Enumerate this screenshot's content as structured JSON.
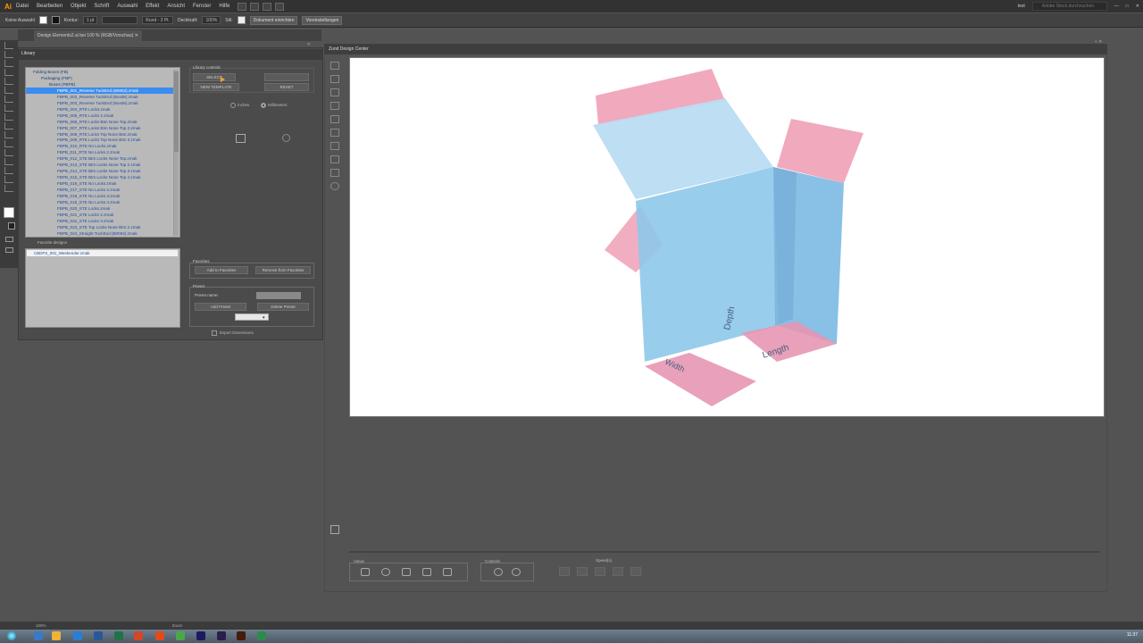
{
  "app": {
    "logo": "Ai",
    "menu": [
      "Datei",
      "Bearbeiten",
      "Objekt",
      "Schrift",
      "Auswahl",
      "Effekt",
      "Ansicht",
      "Fenster",
      "Hilfe"
    ],
    "workspace": "test",
    "search_placeholder": "Adobe Stock durchsuchen"
  },
  "control_bar": {
    "selection": "Keine Auswahl",
    "stroke_label": "Kontur:",
    "stroke_value": "1 pt",
    "brush": "Rund - 3 Pt.",
    "opacity_label": "Deckkraft:",
    "opacity_value": "100%",
    "style_label": "Stil:",
    "doc_setup": "Dokument einrichten",
    "preferences": "Voreinstellungen"
  },
  "document_tab": "Design Elements2.ai bei 100 % (RGB/Vorschau)",
  "library": {
    "title": "Library",
    "tree": [
      {
        "label": "Folding Boxes (FB)",
        "level": 0,
        "group": true
      },
      {
        "label": "Packaging (FBP)",
        "level": 1,
        "group": true
      },
      {
        "label": "Boxes (FBPB)",
        "level": 2,
        "group": true
      },
      {
        "label": "FBPB_001_Reverse TuckEnd (B0002).zmak",
        "level": 3,
        "selected": true
      },
      {
        "label": "FBPB_002_Reverse TuckEnd (Box06).zmak",
        "level": 3
      },
      {
        "label": "FBPB_003_Reverse TuckEnd (Box06).zmak",
        "level": 3
      },
      {
        "label": "FBPB_004_RTE Locks.zmak",
        "level": 3
      },
      {
        "label": "FBPB_005_RTE Locks 2.zmak",
        "level": 3
      },
      {
        "label": "FBPB_006_RTE Locks Btm None Top.zmak",
        "level": 3
      },
      {
        "label": "FBPB_007_RTE Locks Btm None Top 2.zmak",
        "level": 3
      },
      {
        "label": "FBPB_008_RTE Locks Top None Btm.zmak",
        "level": 3
      },
      {
        "label": "FBPB_009_RTE Locks Top None Btm 2.zmak",
        "level": 3
      },
      {
        "label": "FBPB_010_RTE No Locks.zmak",
        "level": 3
      },
      {
        "label": "FBPB_011_RTE No Locks 2.zmak",
        "level": 3
      },
      {
        "label": "FBPB_012_STE Btm Locks None Top.zmak",
        "level": 3
      },
      {
        "label": "FBPB_013_STE Btm Locks None Top 2.zmak",
        "level": 3
      },
      {
        "label": "FBPB_014_STE Btm Locks None Top 3.zmak",
        "level": 3
      },
      {
        "label": "FBPB_015_STE Btm Locks None Top 4.zmak",
        "level": 3
      },
      {
        "label": "FBPB_016_STE No Locks.zmak",
        "level": 3
      },
      {
        "label": "FBPB_017_STE No Locks 2.zmak",
        "level": 3
      },
      {
        "label": "FBPB_018_STE No Locks 3.zmak",
        "level": 3
      },
      {
        "label": "FBPB_019_STE No Locks 4.zmak",
        "level": 3
      },
      {
        "label": "FBPB_020_STE Locks.zmak",
        "level": 3
      },
      {
        "label": "FBPB_021_STE Locks 2.zmak",
        "level": 3
      },
      {
        "label": "FBPB_022_STE Locks 3.zmak",
        "level": 3
      },
      {
        "label": "FBPB_023_STE Top Locks None Btm 2.zmak",
        "level": 3
      },
      {
        "label": "FBPB_024_Straight TuckEnd (B0004).zmak",
        "level": 3
      }
    ],
    "favorite_designs_label": "Favorite designs",
    "favorite_item": "CBDFS_001_Weekender.zmak",
    "controls_title": "Library controls",
    "select_btn": "SELECT",
    "new_template_btn": "NEW TEMPLATE",
    "reset_btn": "RESET",
    "unit_inches": "Inches",
    "unit_mm": "Millimeters",
    "favorites_title": "Favorites",
    "add_fav_btn": "Add to Favorites",
    "remove_fav_btn": "Remove from Favorites",
    "preset_title": "Preset",
    "preset_name_label": "Preset name:",
    "add_preset_btn": "Add Preset",
    "delete_preset_btn": "Delete Preset",
    "export_dims_label": "Export Dimensions"
  },
  "design_center": {
    "title": "Zund Design Center",
    "dims": {
      "depth": "Depth",
      "width": "Width",
      "length": "Length"
    },
    "views_label": "Views",
    "controls_label": "Controls",
    "speed_label": "Speed(s)"
  },
  "statusbar": {
    "zoom": "100%",
    "tool": "Zoom"
  },
  "taskbar": {
    "clock": "11:37"
  },
  "colors": {
    "box_blue": "#8ec8ea",
    "flap_pink": "#f0a0b6",
    "select": "#3a8cf0"
  }
}
